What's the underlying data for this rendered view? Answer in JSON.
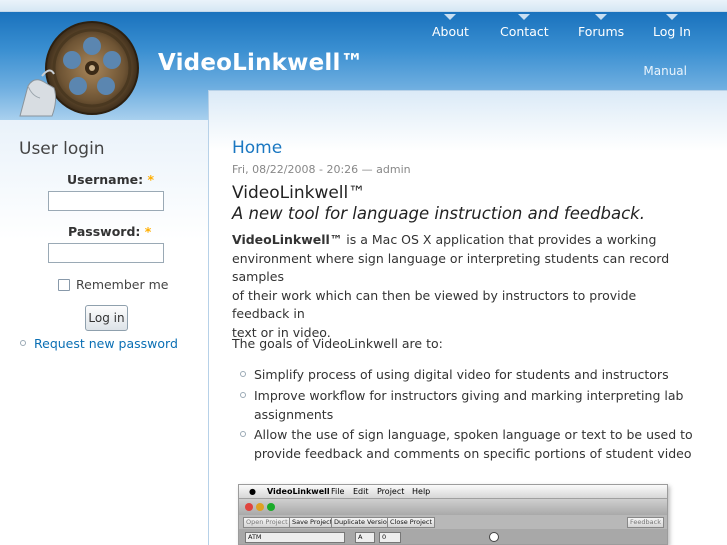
{
  "site": {
    "name": "VideoLinkwell™"
  },
  "nav": {
    "items": [
      "About",
      "Contact",
      "Forums",
      "Log In"
    ],
    "secondary": "Manual"
  },
  "sidebar": {
    "block_title": "User login",
    "username_label": "Username:",
    "password_label": "Password:",
    "required_marker": "*",
    "remember_label": "Remember me",
    "login_button": "Log in",
    "request_password_link": "Request new password"
  },
  "node": {
    "title": "Home",
    "submitted": "Fri, 08/22/2008 - 20:26 — admin",
    "headline": "VideoLinkwell™",
    "tagline": "A new tool for language instruction and feedback.",
    "intro_strong": "VideoLinkwell™",
    "intro_lines": [
      " is a Mac OS X application that provides a working",
      "environment where sign language or interpreting students can record samples",
      "of their work which can then be viewed by instructors to provide feedback in",
      "text or in video."
    ],
    "goals_intro": "The goals of VideoLinkwell are to:",
    "goals": [
      [
        "Simplify process of using digital video for students and instructors"
      ],
      [
        "Improve workflow for instructors giving and marking interpreting lab",
        "assignments"
      ],
      [
        "Allow the use of sign language, spoken language or text to be used to",
        "provide feedback and comments on specific portions of student video"
      ]
    ]
  },
  "app_screenshot": {
    "menu": [
      "VideoLinkwell",
      "File",
      "Edit",
      "Project",
      "Help"
    ],
    "toolbar": [
      "Open Project",
      "Save Project",
      "Duplicate Version",
      "Close Project"
    ],
    "right_button": "Feedback",
    "field_1": "ATM",
    "field_2": "A",
    "field_3": "0"
  },
  "colors": {
    "header_top": "#1a72bd",
    "link": "#0a6fb4",
    "title": "#1a77c1",
    "required": "#ffae00"
  }
}
